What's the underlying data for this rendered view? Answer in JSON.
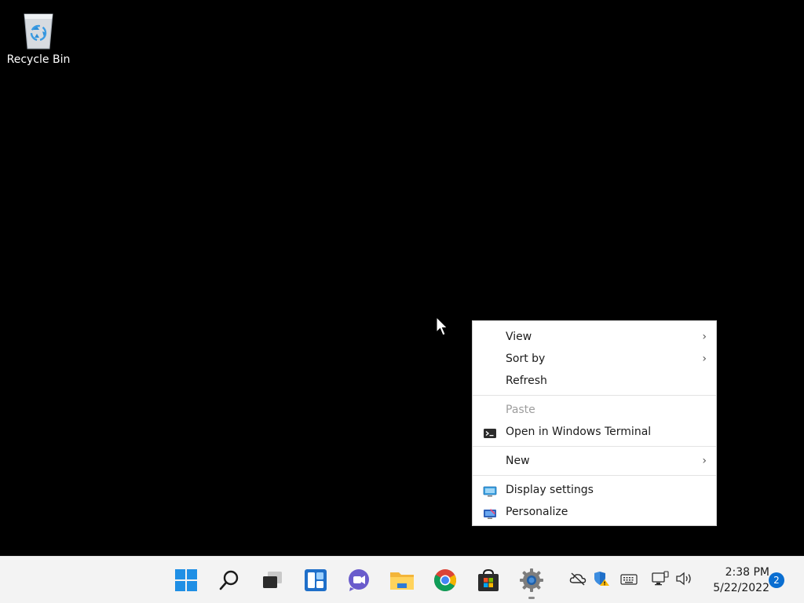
{
  "desktop": {
    "icons": [
      {
        "label": "Recycle Bin",
        "icon": "recycle-bin-icon"
      }
    ]
  },
  "context_menu": {
    "items": [
      {
        "label": "View",
        "has_submenu": true
      },
      {
        "label": "Sort by",
        "has_submenu": true
      },
      {
        "label": "Refresh",
        "has_submenu": false
      },
      {
        "label": "Paste",
        "disabled": true
      },
      {
        "label": "Open in Windows Terminal",
        "icon": "terminal-icon"
      },
      {
        "label": "New",
        "has_submenu": true
      },
      {
        "label": "Display settings",
        "icon": "display-icon"
      },
      {
        "label": "Personalize",
        "icon": "personalize-icon"
      }
    ],
    "chevron": "›"
  },
  "taskbar": {
    "pinned": [
      {
        "name": "start",
        "icon": "windows-logo-icon"
      },
      {
        "name": "search",
        "icon": "search-icon"
      },
      {
        "name": "task-view",
        "icon": "task-view-icon"
      },
      {
        "name": "widgets",
        "icon": "widgets-icon"
      },
      {
        "name": "chat",
        "icon": "teams-chat-icon"
      },
      {
        "name": "file-explorer",
        "icon": "folder-icon"
      },
      {
        "name": "chrome",
        "icon": "chrome-icon"
      },
      {
        "name": "store",
        "icon": "store-icon"
      },
      {
        "name": "settings",
        "icon": "gear-icon",
        "running": true
      }
    ],
    "tray": [
      "onedrive-offline-icon",
      "security-shield-icon",
      "keyboard-icon",
      "network-icon",
      "volume-icon"
    ],
    "clock": {
      "time": "2:38 PM",
      "date": "5/22/2022"
    },
    "notification_count": "2"
  },
  "colors": {
    "desktop_bg": "#000000",
    "taskbar_bg": "#f3f3f3",
    "accent": "#0a6ed1"
  }
}
